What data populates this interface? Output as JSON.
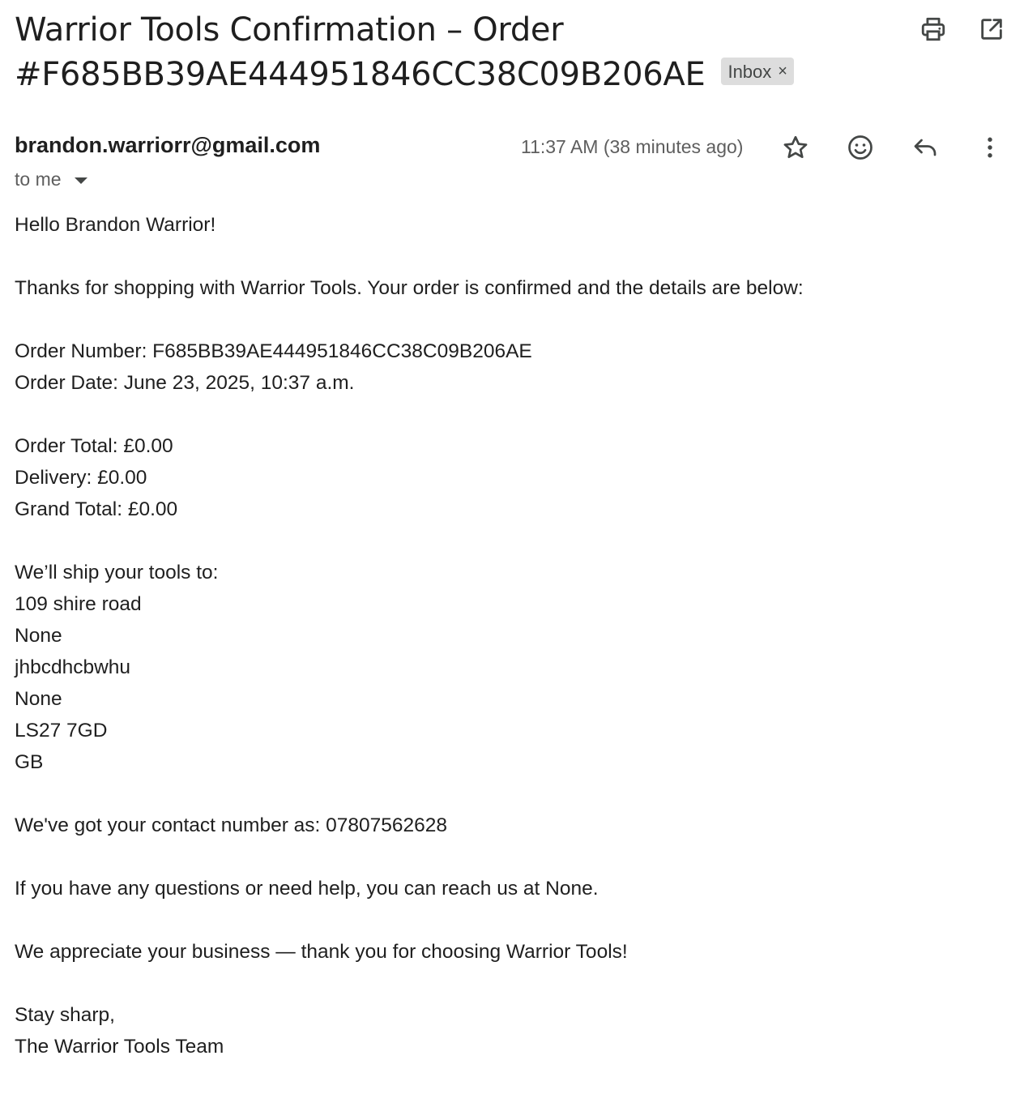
{
  "subject": {
    "line1": "Warrior Tools Confirmation – Order",
    "line2": "#F685BB39AE444951846CC38C09B206AE",
    "label_chip": "Inbox",
    "chip_close": "×"
  },
  "toolbar": {
    "icons": [
      "print-icon",
      "open-in-new-window-icon"
    ]
  },
  "message": {
    "sender": "brandon.warriorr@gmail.com",
    "recipient": "to me",
    "timestamp": "11:37 AM (38 minutes ago)",
    "action_icons": [
      "star-icon",
      "emoji-reaction-icon",
      "reply-icon",
      "more-options-icon"
    ]
  },
  "body": {
    "greeting": "Hello Brandon Warrior!",
    "intro": "Thanks for shopping with Warrior Tools. Your order is confirmed and the details are below:",
    "order_number": "Order Number: F685BB39AE444951846CC38C09B206AE",
    "order_date": "Order Date: June 23, 2025, 10:37 a.m.",
    "order_total": "Order Total: £0.00",
    "delivery": "Delivery: £0.00",
    "grand_total": "Grand Total: £0.00",
    "ship_intro": "We’ll ship your tools to:",
    "address": [
      "109 shire road",
      "None",
      "jhbcdhcbwhu",
      "None",
      "LS27 7GD",
      "GB"
    ],
    "contact": "We've got your contact number as: 07807562628",
    "help": "If you have any questions or need help, you can reach us at None.",
    "thanks": "We appreciate your business — thank you for choosing Warrior Tools!",
    "signoff": "Stay sharp,",
    "signature": "The Warrior Tools Team"
  },
  "colors": {
    "text": "#1f1f1f",
    "muted": "#5e5e5e",
    "chip_bg": "#dddddd",
    "icon": "#444746"
  }
}
